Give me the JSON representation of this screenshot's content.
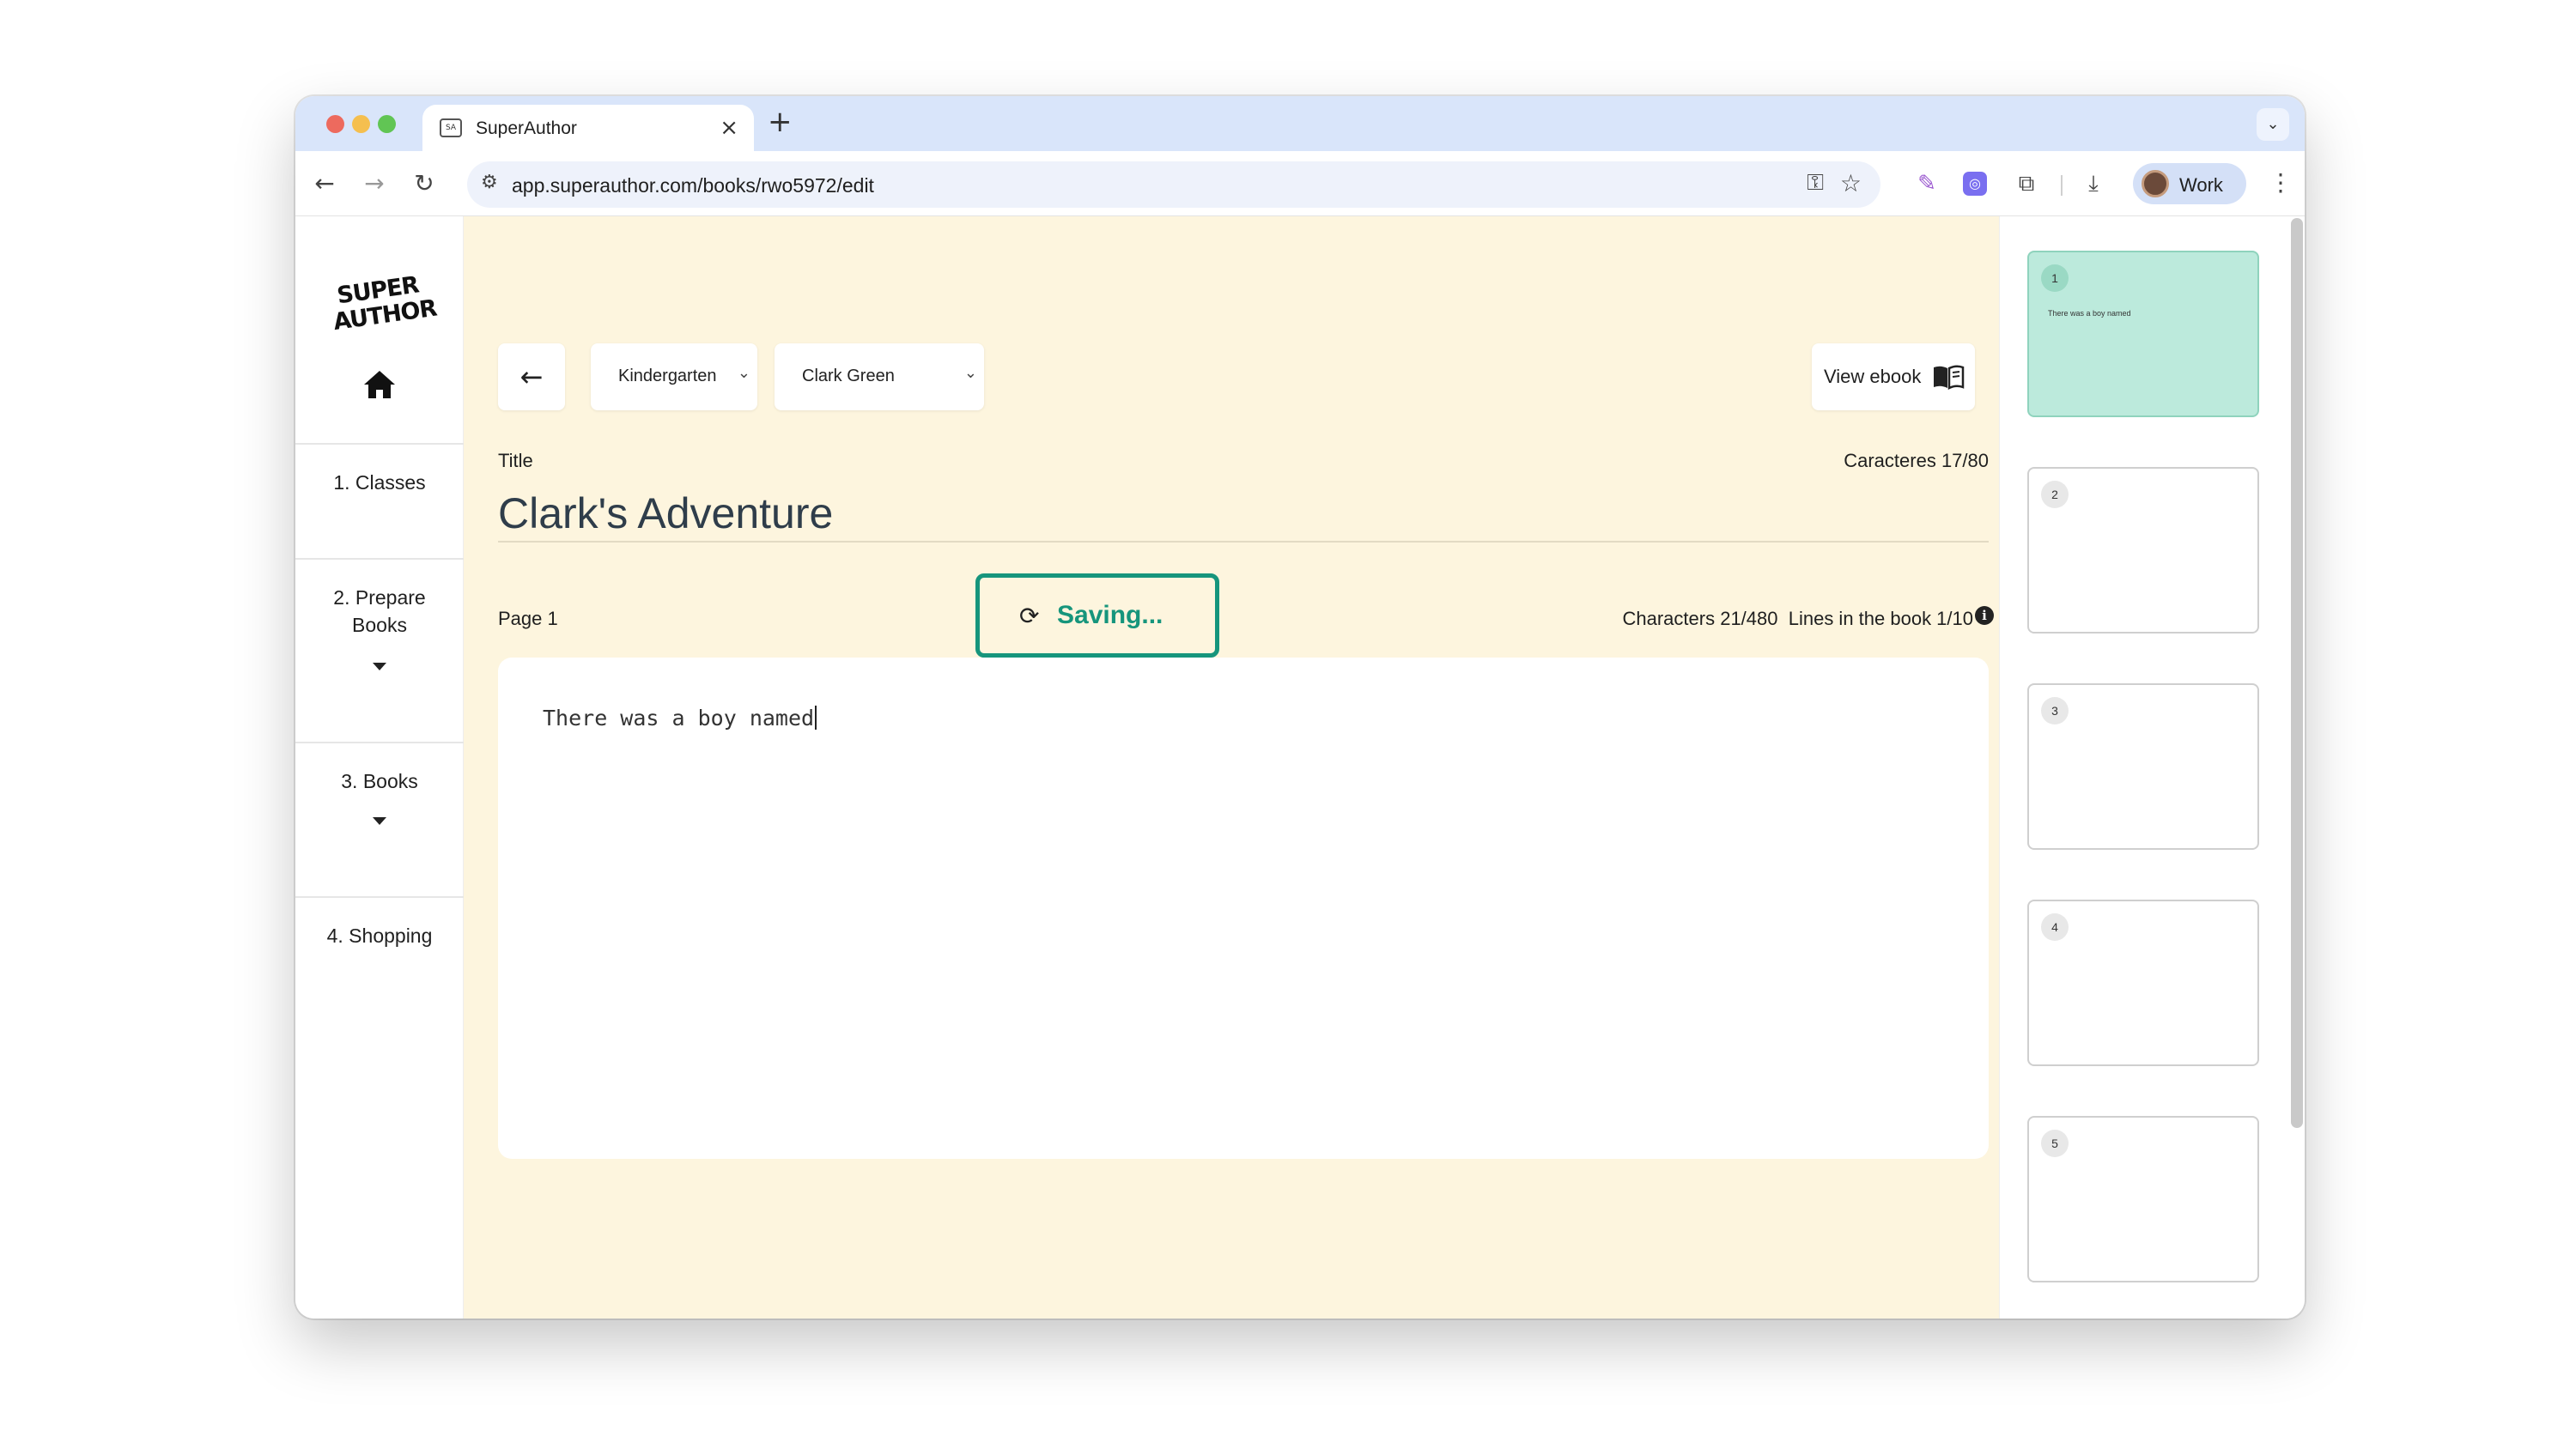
{
  "browser": {
    "tab_title": "SuperAuthor",
    "tab_close": "×",
    "new_tab": "+",
    "tab_search": "⌄",
    "url": "app.superauthor.com/books/rwo5972/edit",
    "profile_label": "Work",
    "icons": {
      "back": "←",
      "forward": "→",
      "reload": "↻",
      "site_settings": "⚙",
      "password_key": "⚿",
      "bookmark_star": "☆",
      "pen": "✎",
      "extension_box": "◎",
      "extensions": "⧉",
      "download": "⤓",
      "menu": "⋮"
    }
  },
  "sidebar": {
    "logo_line1": "SUPER",
    "logo_line2": "AUTHOR",
    "items": [
      {
        "label": "1. Classes"
      },
      {
        "label": "2. Prepare Books"
      },
      {
        "label": "3. Books"
      },
      {
        "label": "4. Shopping"
      }
    ]
  },
  "toolbar": {
    "back_icon": "←",
    "class_select": "Kindergarten",
    "student_select": "Clark Green",
    "chevron": "⌄",
    "view_ebook": "View ebook"
  },
  "book": {
    "title_label": "Title",
    "title_count": "Caracteres 17/80",
    "title": "Clark's Adventure"
  },
  "page": {
    "label": "Page 1",
    "saving_icon": "⟳",
    "saving_text": "Saving...",
    "stats": "Characters 21/480  Lines in the book 1/10",
    "info_icon": "i",
    "text": "There was a boy named"
  },
  "thumbnails": [
    {
      "number": "1",
      "text": "There was a boy named",
      "active": true
    },
    {
      "number": "2",
      "text": "",
      "active": false
    },
    {
      "number": "3",
      "text": "",
      "active": false
    },
    {
      "number": "4",
      "text": "",
      "active": false
    },
    {
      "number": "5",
      "text": "",
      "active": false
    }
  ],
  "colors": {
    "editor_bg": "#fdf5de",
    "accent_green": "#16957c",
    "active_thumb": "#bceadc",
    "tab_strip": "#d9e5fa"
  }
}
